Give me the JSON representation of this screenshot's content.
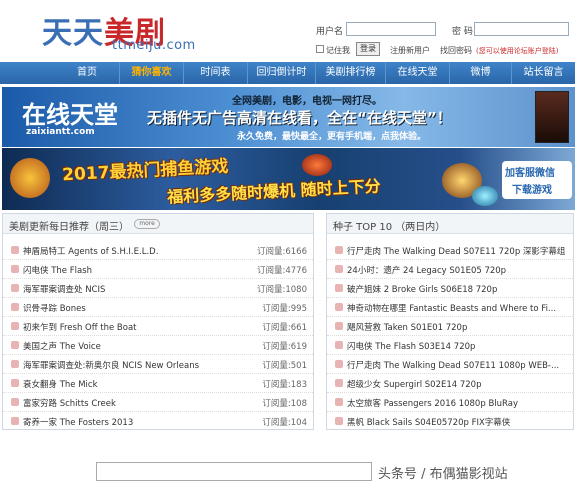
{
  "header": {
    "logo_a": "天天",
    "logo_b": "美剧",
    "logo_en": "ttmeiju.com",
    "login": {
      "user_label": "用户名",
      "pwd_label": "密 码",
      "remember": "记住我",
      "login_btn": "登录",
      "register": "注册新用户",
      "forgot": "找回密码",
      "hint": "(您可以使用论坛账户登陆)"
    }
  },
  "nav": {
    "items": [
      "首页",
      "猜你喜欢",
      "时间表",
      "回归倒计时",
      "美剧排行榜",
      "在线天堂",
      "微博",
      "站长留言"
    ]
  },
  "banner1": {
    "logo": "在线天堂",
    "url": "zaixiantt.com",
    "line1": "全网美剧，电影，电视一网打尽。",
    "line2": "无插件无广告高清在线看，全在“在线天堂”！",
    "line3": "永久免费，最快最全，更有手机端，点我体验。"
  },
  "banner2": {
    "title": "2017最热门捕鱼游戏",
    "sub": "福利多多随时爆机  随时上下分",
    "right_a": "加客服微信",
    "right_b": "下载游戏"
  },
  "left_panel": {
    "title": "美剧更新每日推荐（周三）",
    "more": "more",
    "rows": [
      {
        "title": "神盾局特工 Agents of S.H.I.E.L.D.",
        "views": "订阅量:6166"
      },
      {
        "title": "闪电侠 The Flash",
        "views": "订阅量:4776"
      },
      {
        "title": "海军罪案调查处 NCIS",
        "views": "订阅量:1080"
      },
      {
        "title": "识骨寻踪 Bones",
        "views": "订阅量:995"
      },
      {
        "title": "初来乍到 Fresh Off the Boat",
        "views": "订阅量:661"
      },
      {
        "title": "美国之声 The Voice",
        "views": "订阅量:619"
      },
      {
        "title": "海军罪案调查处:新奥尔良 NCIS New Orleans",
        "views": "订阅量:501"
      },
      {
        "title": "衰女翻身 The Mick",
        "views": "订阅量:183"
      },
      {
        "title": "富家穷路 Schitts Creek",
        "views": "订阅量:108"
      },
      {
        "title": "寄养一家 The Fosters 2013",
        "views": "订阅量:104"
      }
    ]
  },
  "right_panel": {
    "title": "种子 TOP 10 （两日内）",
    "rows": [
      {
        "title": "行尸走肉 The Walking Dead S07E11 720p 深影字幕组"
      },
      {
        "title": "24小时：遗产 24 Legacy S01E05 720p"
      },
      {
        "title": "破产姐妹 2 Broke Girls S06E18 720p"
      },
      {
        "title": "神奇动物在哪里 Fantastic Beasts and Where to Fi..."
      },
      {
        "title": "飓风营救 Taken S01E01 720p"
      },
      {
        "title": "闪电侠 The Flash S03E14 720p"
      },
      {
        "title": "行尸走肉 The Walking Dead S07E11 1080p WEB-..."
      },
      {
        "title": "超级少女 Supergirl S02E14 720p"
      },
      {
        "title": "太空旅客 Passengers 2016 1080p BluRay"
      },
      {
        "title": "黑帆 Black Sails S04E05720p FIX字幕侠"
      }
    ]
  },
  "watermark": "头条号 / 布偶猫影视站"
}
